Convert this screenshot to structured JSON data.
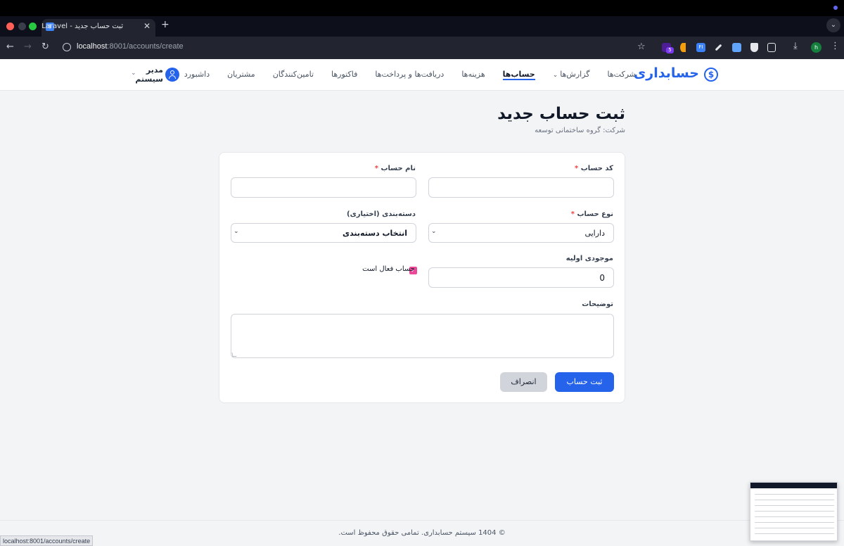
{
  "browser": {
    "tab_title": "ثبت حساب جدید - Laravel",
    "tab_favicon": "$",
    "url_host": "localhost",
    "url_path": ":8001/accounts/create",
    "profile_initial": "h",
    "ext_badge": "5",
    "status_url": "localhost:8001/accounts/create"
  },
  "header": {
    "logo_text": "حسابداری",
    "logo_symbol": "$",
    "nav": [
      {
        "label": "داشبورد"
      },
      {
        "label": "مشتریان"
      },
      {
        "label": "تامین‌کنندگان"
      },
      {
        "label": "فاکتورها"
      },
      {
        "label": "دریافت‌ها و پرداخت‌ها"
      },
      {
        "label": "هزینه‌ها"
      },
      {
        "label": "حساب‌ها"
      },
      {
        "label": "گزارش‌ها"
      },
      {
        "label": "شرکت‌ها"
      }
    ],
    "user_name": "مدیر سیستم"
  },
  "page": {
    "title": "ثبت حساب جدید",
    "subtitle": "شرکت: گروه ساختمانی توسعه"
  },
  "form": {
    "code_label": "کد حساب",
    "name_label": "نام حساب",
    "type_label": "نوع حساب",
    "type_value": "دارایی",
    "category_label": "دسته‌بندی (اختیاری)",
    "category_value": "انتخاب دسته‌بندی",
    "balance_label": "موجودی اولیه",
    "balance_value": "0",
    "active_label": "حساب فعال است",
    "notes_label": "توضیحات",
    "required_mark": "*",
    "submit_label": "ثبت حساب",
    "cancel_label": "انصراف"
  },
  "footer": {
    "text": "© 1404 سیستم حسابداری. تمامی حقوق محفوظ است."
  },
  "colors": {
    "primary": "#2563eb",
    "checkbox": "#ec4899",
    "required": "#ef4444"
  }
}
